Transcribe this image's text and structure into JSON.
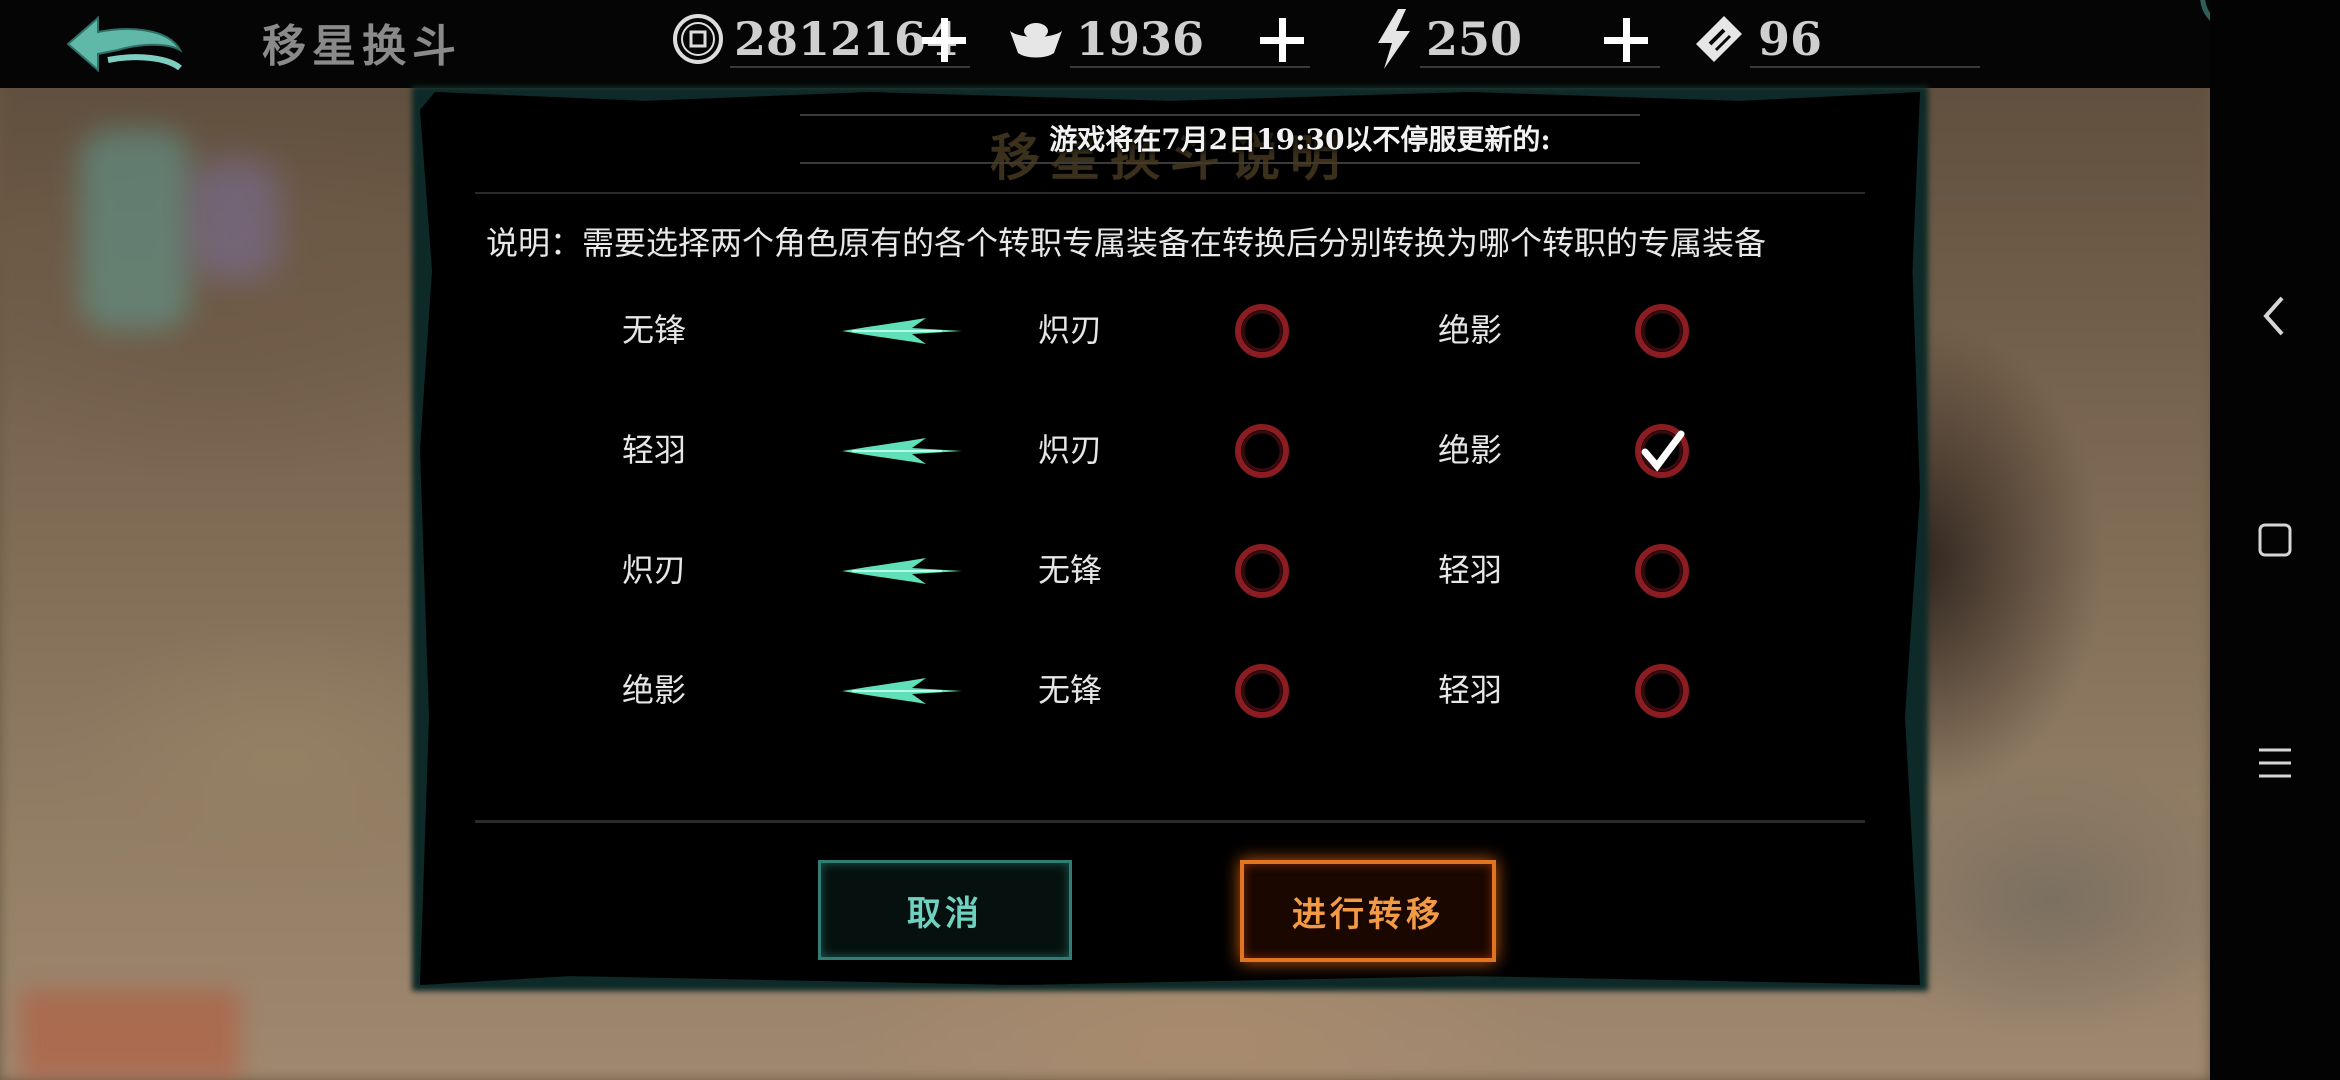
{
  "header": {
    "title": "移星换斗",
    "resources": [
      {
        "icon": "copper-coin-icon",
        "value": "2812164"
      },
      {
        "icon": "silver-ingot-icon",
        "value": "1936"
      },
      {
        "icon": "lightning-energy-icon",
        "value": "250"
      },
      {
        "icon": "ticket-icon",
        "value": "96"
      }
    ]
  },
  "dialog": {
    "title": "移星换斗说明",
    "notice": "游戏将在7月2日19:30以不停服更新的:",
    "description": "说明：需要选择两个角色原有的各个转职专属装备在转换后分别转换为哪个转职的专属装备",
    "rows": [
      {
        "from": "无锋",
        "option_a": "炽刃",
        "option_a_checked": false,
        "option_b": "绝影",
        "option_b_checked": false
      },
      {
        "from": "轻羽",
        "option_a": "炽刃",
        "option_a_checked": false,
        "option_b": "绝影",
        "option_b_checked": true
      },
      {
        "from": "炽刃",
        "option_a": "无锋",
        "option_a_checked": false,
        "option_b": "轻羽",
        "option_b_checked": false
      },
      {
        "from": "绝影",
        "option_a": "无锋",
        "option_a_checked": false,
        "option_b": "轻羽",
        "option_b_checked": false
      }
    ],
    "cancel_label": "取消",
    "confirm_label": "进行转移"
  },
  "colors": {
    "cancel_accent": "#2f7d73",
    "confirm_accent": "#e07420",
    "arrow": "#5fe0b8",
    "radio_ring": "#8a1c22"
  }
}
